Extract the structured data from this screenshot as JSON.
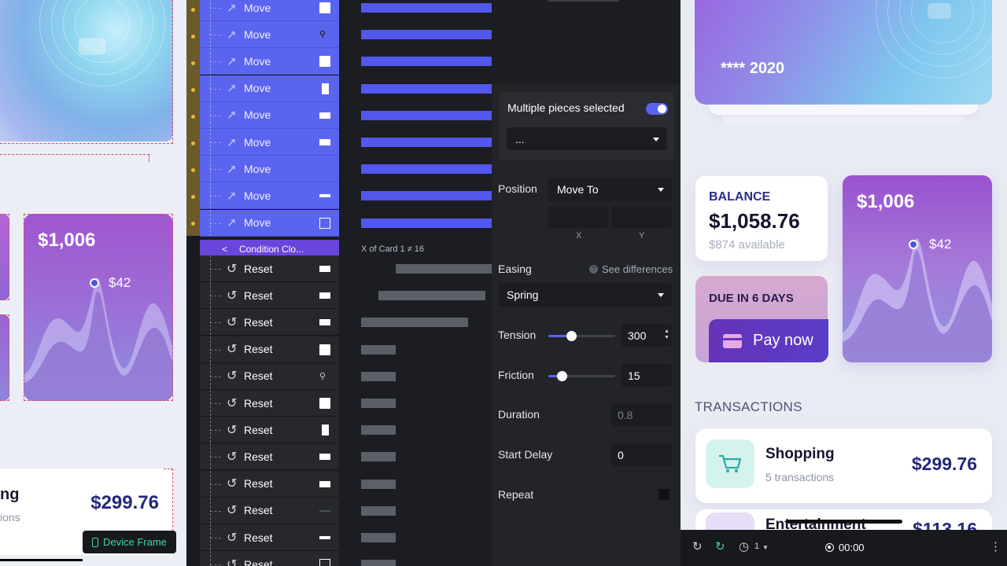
{
  "timeline": {
    "move_label": "Move",
    "reset_label": "Reset",
    "condition_label": "Condition Clo...",
    "condition_expr": "X of Card 1 ≠ 16"
  },
  "properties": {
    "multi_title": "Multiple pieces selected",
    "multi_select_value": "...",
    "position_label": "Position",
    "position_value": "Move To",
    "x_label": "X",
    "y_label": "Y",
    "easing_label": "Easing",
    "see_differences": "See differences",
    "easing_value": "Spring",
    "tension_label": "Tension",
    "tension_value": "300",
    "tension_level": 0.34,
    "friction_label": "Friction",
    "friction_value": "15",
    "friction_level": 0.2,
    "duration_label": "Duration",
    "duration_value": "0.8",
    "start_delay_label": "Start Delay",
    "start_delay_value": "0",
    "repeat_label": "Repeat"
  },
  "left_canvas": {
    "chart_amount": "$1,006",
    "chart_point": "$42",
    "tx_name": "ng",
    "tx_sub": "ions",
    "tx_price": "$299.76",
    "device_frame": "Device Frame"
  },
  "right_canvas": {
    "card_masked": "**** 2020",
    "balance_label": "BALANCE",
    "balance_value": "$1,058.76",
    "balance_available": "$874 available",
    "due_label": "DUE IN 6 DAYS",
    "pay_now": "Pay now",
    "chart_amount": "$1,006",
    "chart_point": "$42",
    "transactions_heading": "TRANSACTIONS",
    "tx1_name": "Shopping",
    "tx1_sub": "5 transactions",
    "tx1_price": "$299.76",
    "tx2_name": "Entertainment",
    "tx2_price": "$113.16"
  },
  "player": {
    "speed": "1",
    "time": "00:00"
  },
  "colors": {
    "accent": "#5b64ef",
    "condition": "#6a45dc",
    "brand_navy": "#25287a"
  }
}
